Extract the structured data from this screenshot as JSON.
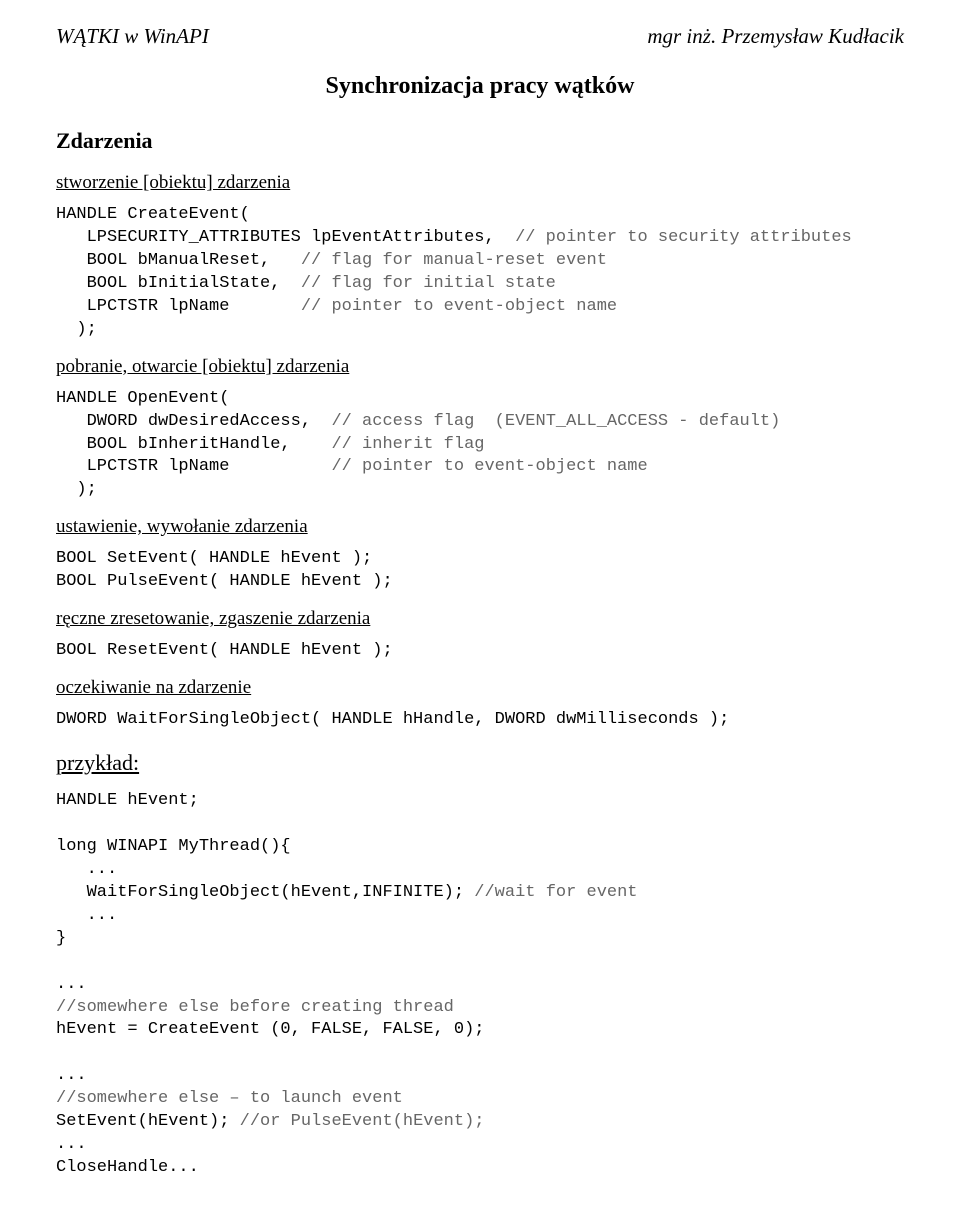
{
  "header": {
    "left": "WĄTKI w WinAPI",
    "right": "mgr inż. Przemysław Kudłacik"
  },
  "centerTitle": "Synchronizacja pracy wątków",
  "sectionTitle": "Zdarzenia",
  "sub_create": "stworzenie [obiektu] zdarzenia",
  "code_create_l1": "HANDLE CreateEvent(",
  "code_create_l2a": "   LPSECURITY_ATTRIBUTES lpEventAttributes,  ",
  "code_create_l2c": "// pointer to security attributes",
  "code_create_l3a": "   BOOL bManualReset,   ",
  "code_create_l3c": "// flag for manual-reset event",
  "code_create_l4a": "   BOOL bInitialState,  ",
  "code_create_l4c": "// flag for initial state",
  "code_create_l5a": "   LPCTSTR lpName       ",
  "code_create_l5c": "// pointer to event-object name",
  "code_create_l6": "  );",
  "sub_open": "pobranie, otwarcie [obiektu] zdarzenia",
  "code_open_l1": "HANDLE OpenEvent(",
  "code_open_l2a": "   DWORD dwDesiredAccess,  ",
  "code_open_l2c": "// access flag  (EVENT_ALL_ACCESS - default)",
  "code_open_l3a": "   BOOL bInheritHandle,    ",
  "code_open_l3c": "// inherit flag",
  "code_open_l4a": "   LPCTSTR lpName          ",
  "code_open_l4c": "// pointer to event-object name",
  "code_open_l5": "  );",
  "sub_set": "ustawienie, wywołanie zdarzenia",
  "code_set_l1": "BOOL SetEvent( HANDLE hEvent );",
  "code_set_l2": "BOOL PulseEvent( HANDLE hEvent );",
  "sub_reset": "ręczne zresetowanie, zgaszenie zdarzenia",
  "code_reset_l1": "BOOL ResetEvent( HANDLE hEvent );",
  "sub_wait": "oczekiwanie na zdarzenie",
  "code_wait_l1": "DWORD WaitForSingleObject( HANDLE hHandle, DWORD dwMilliseconds );",
  "example_heading": "przykład:",
  "ex_l1": "HANDLE hEvent;",
  "ex_l2": "long WINAPI MyThread(){",
  "ex_l3": "   ...",
  "ex_l4a": "   WaitForSingleObject(hEvent,INFINITE); ",
  "ex_l4c": "//wait for event",
  "ex_l5": "   ...",
  "ex_l6": "}",
  "ex_l7": "...",
  "ex_l8c": "//somewhere else before creating thread",
  "ex_l9": "hEvent = CreateEvent (0, FALSE, FALSE, 0);",
  "ex_l10": "...",
  "ex_l11c": "//somewhere else – to launch event",
  "ex_l12a": "SetEvent(hEvent); ",
  "ex_l12c": "//or PulseEvent(hEvent);",
  "ex_l13": "...",
  "ex_l14": "CloseHandle..."
}
